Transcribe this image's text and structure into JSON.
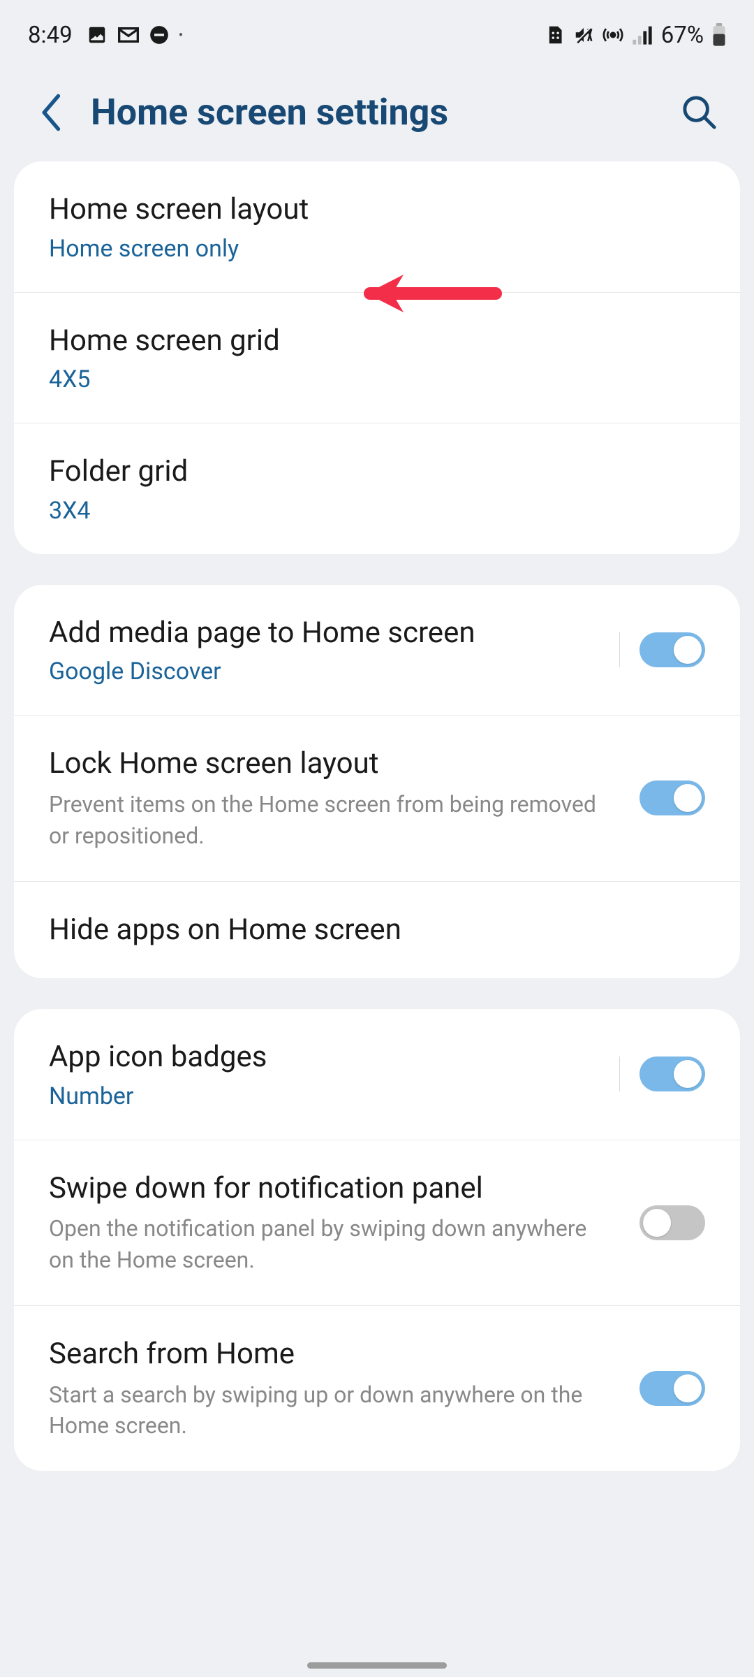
{
  "status": {
    "time": "8:49",
    "battery": "67%"
  },
  "header": {
    "title": "Home screen settings"
  },
  "groups": [
    {
      "rows": [
        {
          "title": "Home screen layout",
          "subtitle": "Home screen only"
        },
        {
          "title": "Home screen grid",
          "subtitle": "4X5"
        },
        {
          "title": "Folder grid",
          "subtitle": "3X4"
        }
      ]
    },
    {
      "rows": [
        {
          "title": "Add media page to Home screen",
          "subtitle": "Google Discover"
        },
        {
          "title": "Lock Home screen layout",
          "description": "Prevent items on the Home screen from being removed or repositioned."
        },
        {
          "title": "Hide apps on Home screen"
        }
      ]
    },
    {
      "rows": [
        {
          "title": "App icon badges",
          "subtitle": "Number"
        },
        {
          "title": "Swipe down for notification panel",
          "description": "Open the notification panel by swiping down anywhere on the Home screen."
        },
        {
          "title": "Search from Home",
          "description": "Start a search by swiping up or down anywhere on the Home screen."
        }
      ]
    }
  ]
}
